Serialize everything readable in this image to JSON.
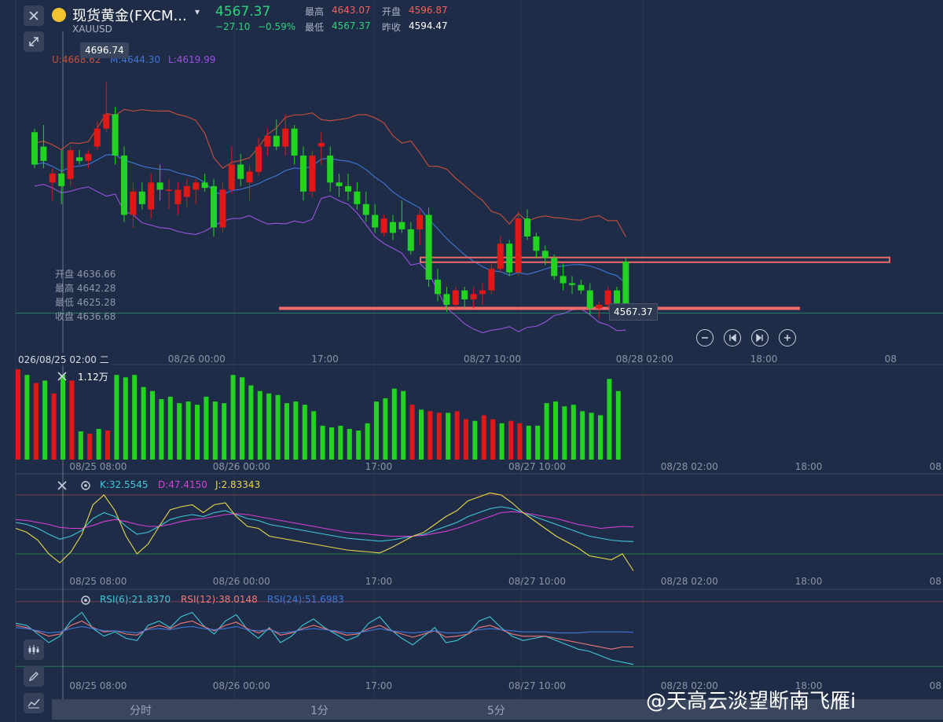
{
  "header": {
    "instrument_name": "现货黄金(FXCM...",
    "symbol": "XAUUSD",
    "price": "4567.37",
    "change": "−27.10",
    "change_pct": "−0.59%",
    "high_label": "最高",
    "high_value": "4643.07",
    "open_label": "开盘",
    "open_value": "4596.87",
    "low_label": "最低",
    "low_value": "4567.37",
    "prev_close_label": "昨收",
    "prev_close_value": "4594.47"
  },
  "toolbar": {
    "close_icon": "close-icon",
    "collapse_icon": "collapse-arrows-icon",
    "zoom_out_icon": "minus-icon",
    "first_icon": "skip-to-start-icon",
    "last_icon": "skip-to-end-icon",
    "zoom_in_icon": "plus-icon",
    "indicator_icon": "candles-icon",
    "draw_icon": "pencil-icon",
    "chart_settings_icon": "line-chart-icon"
  },
  "price_panel": {
    "bands_upper": "U:4668.62",
    "bands_middle": "M:4644.30",
    "bands_lower": "L:4619.99",
    "max_price_label": "4696.74",
    "current_price_label": "4567.37",
    "ohlc_info": {
      "open": "开盘 4636.66",
      "high": "最高 4642.28",
      "low": "最低 4625.28",
      "close": "收盘 4636.68"
    },
    "crosshair_time": "026/08/25 02:00 二"
  },
  "time_ticks": [
    {
      "t": 3,
      "label": "08:00"
    },
    {
      "t": 17,
      "label": "08/26 00:00"
    },
    {
      "t": 33,
      "label": "17:00"
    },
    {
      "t": 50,
      "label": "08/27 10:00"
    },
    {
      "t": 67,
      "label": "08/28 02:00"
    },
    {
      "t": 82,
      "label": "18:00"
    },
    {
      "t": 97,
      "label": "08"
    }
  ],
  "volume_ticks": [
    {
      "t": 6,
      "label": "08/25 08:00"
    },
    {
      "t": 22,
      "label": "08/26 00:00"
    },
    {
      "t": 39,
      "label": "17:00"
    },
    {
      "t": 55,
      "label": "08/27 10:00"
    },
    {
      "t": 72,
      "label": "08/28 02:00"
    },
    {
      "t": 87,
      "label": "18:00"
    },
    {
      "t": 102,
      "label": "08"
    }
  ],
  "volume_panel": {
    "label": "1.12万"
  },
  "kdj_panel": {
    "k": "K:32.5545",
    "d": "D:47.4150",
    "j": "J:2.83343"
  },
  "rsi_panel": {
    "rsi6": "RSI(6):21.8370",
    "rsi12": "RSI(12):38.0148",
    "rsi24": "RSI(24):51.6983"
  },
  "bottom_tabs": [
    "分时",
    "1分",
    "5分"
  ],
  "watermark": "@天高云淡望断南飞雁i",
  "colors": {
    "up": "#e01818",
    "down": "#22d322",
    "upper_band": "#c8503c",
    "middle_band": "#3f78d9",
    "lower_band": "#9a52e0",
    "k": "#3ec8d8",
    "d": "#d640d6",
    "j": "#e8d84a",
    "rsi6": "#3ec8d8",
    "rsi12": "#f07878",
    "rsi24": "#3f78d9",
    "support_line": "#f06a6a"
  },
  "chart_data": [
    {
      "type": "candlestick",
      "title": "",
      "ylim": [
        4558,
        4700
      ],
      "support_levels": [
        4597,
        4570
      ],
      "candles": [
        {
          "o": 4668,
          "h": 4670,
          "l": 4648,
          "c": 4650
        },
        {
          "o": 4660,
          "h": 4672,
          "l": 4648,
          "c": 4652
        },
        {
          "o": 4640,
          "h": 4648,
          "l": 4630,
          "c": 4645
        },
        {
          "o": 4645,
          "h": 4658,
          "l": 4628,
          "c": 4638
        },
        {
          "o": 4642,
          "h": 4660,
          "l": 4638,
          "c": 4658
        },
        {
          "o": 4654,
          "h": 4658,
          "l": 4650,
          "c": 4652
        },
        {
          "o": 4652,
          "h": 4658,
          "l": 4648,
          "c": 4656
        },
        {
          "o": 4660,
          "h": 4674,
          "l": 4658,
          "c": 4670
        },
        {
          "o": 4670,
          "h": 4696,
          "l": 4668,
          "c": 4678
        },
        {
          "o": 4678,
          "h": 4682,
          "l": 4650,
          "c": 4655
        },
        {
          "o": 4655,
          "h": 4660,
          "l": 4618,
          "c": 4622
        },
        {
          "o": 4622,
          "h": 4640,
          "l": 4615,
          "c": 4635
        },
        {
          "o": 4635,
          "h": 4640,
          "l": 4625,
          "c": 4628
        },
        {
          "o": 4625,
          "h": 4645,
          "l": 4620,
          "c": 4640
        },
        {
          "o": 4640,
          "h": 4650,
          "l": 4630,
          "c": 4636
        },
        {
          "o": 4636,
          "h": 4642,
          "l": 4625,
          "c": 4636
        },
        {
          "o": 4628,
          "h": 4640,
          "l": 4622,
          "c": 4636
        },
        {
          "o": 4632,
          "h": 4642,
          "l": 4626,
          "c": 4638
        },
        {
          "o": 4636,
          "h": 4642,
          "l": 4628,
          "c": 4640
        },
        {
          "o": 4640,
          "h": 4645,
          "l": 4635,
          "c": 4637
        },
        {
          "o": 4638,
          "h": 4642,
          "l": 4610,
          "c": 4615
        },
        {
          "o": 4615,
          "h": 4640,
          "l": 4612,
          "c": 4636
        },
        {
          "o": 4636,
          "h": 4660,
          "l": 4634,
          "c": 4650
        },
        {
          "o": 4650,
          "h": 4656,
          "l": 4638,
          "c": 4642
        },
        {
          "o": 4640,
          "h": 4650,
          "l": 4630,
          "c": 4646
        },
        {
          "o": 4646,
          "h": 4665,
          "l": 4644,
          "c": 4660
        },
        {
          "o": 4660,
          "h": 4670,
          "l": 4655,
          "c": 4666
        },
        {
          "o": 4666,
          "h": 4675,
          "l": 4658,
          "c": 4660
        },
        {
          "o": 4660,
          "h": 4678,
          "l": 4655,
          "c": 4670
        },
        {
          "o": 4670,
          "h": 4672,
          "l": 4650,
          "c": 4655
        },
        {
          "o": 4655,
          "h": 4660,
          "l": 4630,
          "c": 4635
        },
        {
          "o": 4635,
          "h": 4658,
          "l": 4632,
          "c": 4655
        },
        {
          "o": 4660,
          "h": 4668,
          "l": 4650,
          "c": 4662
        },
        {
          "o": 4655,
          "h": 4660,
          "l": 4635,
          "c": 4640
        },
        {
          "o": 4640,
          "h": 4645,
          "l": 4632,
          "c": 4638
        },
        {
          "o": 4638,
          "h": 4645,
          "l": 4630,
          "c": 4635
        },
        {
          "o": 4635,
          "h": 4640,
          "l": 4625,
          "c": 4628
        },
        {
          "o": 4628,
          "h": 4635,
          "l": 4618,
          "c": 4622
        },
        {
          "o": 4622,
          "h": 4628,
          "l": 4612,
          "c": 4615
        },
        {
          "o": 4612,
          "h": 4622,
          "l": 4610,
          "c": 4620
        },
        {
          "o": 4618,
          "h": 4622,
          "l": 4608,
          "c": 4612
        },
        {
          "o": 4618,
          "h": 4630,
          "l": 4612,
          "c": 4614
        },
        {
          "o": 4614,
          "h": 4618,
          "l": 4600,
          "c": 4602
        },
        {
          "o": 4614,
          "h": 4625,
          "l": 4605,
          "c": 4622
        },
        {
          "o": 4622,
          "h": 4626,
          "l": 4582,
          "c": 4586
        },
        {
          "o": 4586,
          "h": 4592,
          "l": 4574,
          "c": 4578
        },
        {
          "o": 4578,
          "h": 4582,
          "l": 4568,
          "c": 4572
        },
        {
          "o": 4572,
          "h": 4582,
          "l": 4570,
          "c": 4580
        },
        {
          "o": 4580,
          "h": 4582,
          "l": 4570,
          "c": 4575
        },
        {
          "o": 4575,
          "h": 4582,
          "l": 4570,
          "c": 4578
        },
        {
          "o": 4578,
          "h": 4584,
          "l": 4572,
          "c": 4580
        },
        {
          "o": 4580,
          "h": 4595,
          "l": 4578,
          "c": 4592
        },
        {
          "o": 4592,
          "h": 4610,
          "l": 4590,
          "c": 4606
        },
        {
          "o": 4606,
          "h": 4608,
          "l": 4588,
          "c": 4590
        },
        {
          "o": 4590,
          "h": 4624,
          "l": 4588,
          "c": 4620
        },
        {
          "o": 4620,
          "h": 4625,
          "l": 4608,
          "c": 4610
        },
        {
          "o": 4610,
          "h": 4612,
          "l": 4598,
          "c": 4602
        },
        {
          "o": 4602,
          "h": 4605,
          "l": 4594,
          "c": 4598
        },
        {
          "o": 4598,
          "h": 4600,
          "l": 4586,
          "c": 4588
        },
        {
          "o": 4588,
          "h": 4595,
          "l": 4580,
          "c": 4584
        },
        {
          "o": 4584,
          "h": 4588,
          "l": 4578,
          "c": 4583
        },
        {
          "o": 4583,
          "h": 4586,
          "l": 4578,
          "c": 4580
        },
        {
          "o": 4580,
          "h": 4584,
          "l": 4566,
          "c": 4570
        },
        {
          "o": 4570,
          "h": 4574,
          "l": 4564,
          "c": 4572
        },
        {
          "o": 4572,
          "h": 4582,
          "l": 4570,
          "c": 4580
        },
        {
          "o": 4580,
          "h": 4582,
          "l": 4568,
          "c": 4572
        },
        {
          "o": 4596,
          "h": 4598,
          "l": 4566,
          "c": 4567
        }
      ]
    },
    {
      "type": "bar",
      "title": "",
      "values": [
        1.12,
        1.05,
        0.95,
        0.98,
        0.82,
        1.05,
        0.98,
        0.35,
        0.32,
        0.38,
        0.36,
        1.05,
        1.02,
        1.05,
        0.9,
        0.85,
        0.75,
        0.78,
        0.7,
        0.72,
        0.68,
        0.78,
        0.72,
        0.7,
        1.05,
        1.02,
        0.92,
        0.85,
        0.82,
        0.8,
        0.7,
        0.72,
        0.68,
        0.6,
        0.42,
        0.4,
        0.42,
        0.38,
        0.36,
        0.45,
        0.72,
        0.76,
        0.88,
        0.85,
        0.68,
        0.62,
        0.6,
        0.58,
        0.58,
        0.6,
        0.5,
        0.48,
        0.55,
        0.5,
        0.45,
        0.48,
        0.45,
        0.42,
        0.42,
        0.7,
        0.72,
        0.66,
        0.68,
        0.6,
        0.58,
        0.55,
        1.0,
        0.85
      ],
      "ylim": [
        0,
        1.12
      ]
    },
    {
      "type": "line",
      "title": "",
      "series": [
        {
          "name": "K",
          "values": [
            52,
            50,
            46,
            40,
            35,
            38,
            44,
            56,
            62,
            58,
            48,
            40,
            42,
            48,
            55,
            58,
            60,
            58,
            62,
            64,
            60,
            56,
            54,
            50,
            48,
            46,
            44,
            42,
            40,
            38,
            36,
            35,
            34,
            33,
            34,
            36,
            38,
            40,
            44,
            48,
            52,
            58,
            62,
            66,
            68,
            66,
            62,
            58,
            54,
            50,
            46,
            42,
            38,
            36,
            34,
            33,
            32.5545
          ]
        },
        {
          "name": "D",
          "values": [
            55,
            54,
            52,
            50,
            47,
            46,
            46,
            49,
            53,
            55,
            53,
            50,
            48,
            48,
            50,
            53,
            55,
            56,
            58,
            60,
            61,
            60,
            58,
            56,
            54,
            52,
            50,
            48,
            46,
            44,
            42,
            41,
            40,
            39,
            38,
            38,
            38,
            39,
            41,
            43,
            46,
            50,
            54,
            58,
            62,
            63,
            62,
            60,
            58,
            56,
            53,
            50,
            48,
            46,
            47,
            48,
            47.415
          ]
        },
        {
          "name": "J",
          "values": [
            46,
            42,
            34,
            20,
            11,
            22,
            40,
            70,
            80,
            64,
            38,
            20,
            30,
            48,
            65,
            68,
            70,
            62,
            70,
            72,
            58,
            48,
            46,
            38,
            36,
            34,
            32,
            30,
            28,
            26,
            24,
            23,
            22,
            21,
            26,
            32,
            38,
            42,
            50,
            58,
            64,
            74,
            78,
            82,
            80,
            72,
            62,
            54,
            46,
            38,
            32,
            26,
            18,
            16,
            14,
            20,
            2.83343
          ]
        }
      ],
      "ylim": [
        0,
        100
      ]
    },
    {
      "type": "line",
      "title": "",
      "series": [
        {
          "name": "RSI(6)",
          "values": [
            60,
            58,
            50,
            42,
            48,
            62,
            70,
            55,
            48,
            52,
            46,
            44,
            58,
            62,
            56,
            66,
            70,
            58,
            50,
            62,
            68,
            54,
            46,
            56,
            42,
            48,
            58,
            64,
            56,
            50,
            44,
            48,
            60,
            66,
            54,
            46,
            40,
            48,
            56,
            42,
            44,
            50,
            62,
            66,
            56,
            48,
            44,
            46,
            48,
            44,
            40,
            36,
            34,
            30,
            26,
            24,
            21.837
          ]
        },
        {
          "name": "RSI(12)",
          "values": [
            58,
            56,
            52,
            48,
            50,
            58,
            62,
            56,
            52,
            53,
            50,
            49,
            55,
            58,
            55,
            60,
            62,
            57,
            53,
            58,
            61,
            55,
            51,
            55,
            49,
            51,
            55,
            58,
            55,
            52,
            49,
            50,
            55,
            58,
            53,
            50,
            47,
            50,
            53,
            47,
            48,
            50,
            56,
            58,
            54,
            50,
            48,
            48,
            48,
            46,
            44,
            42,
            40,
            38,
            36,
            38,
            38.0148
          ]
        },
        {
          "name": "RSI(24)",
          "values": [
            56,
            55,
            53,
            51,
            52,
            55,
            57,
            55,
            53,
            53,
            52,
            51,
            54,
            55,
            54,
            56,
            57,
            55,
            54,
            55,
            57,
            54,
            53,
            54,
            51,
            52,
            54,
            55,
            54,
            53,
            51,
            51,
            53,
            55,
            53,
            52,
            51,
            52,
            53,
            51,
            51,
            52,
            54,
            55,
            54,
            53,
            52,
            52,
            52,
            51,
            51,
            51,
            52,
            52,
            52,
            52,
            51.6983
          ]
        }
      ],
      "ylim": [
        10,
        90
      ]
    }
  ]
}
